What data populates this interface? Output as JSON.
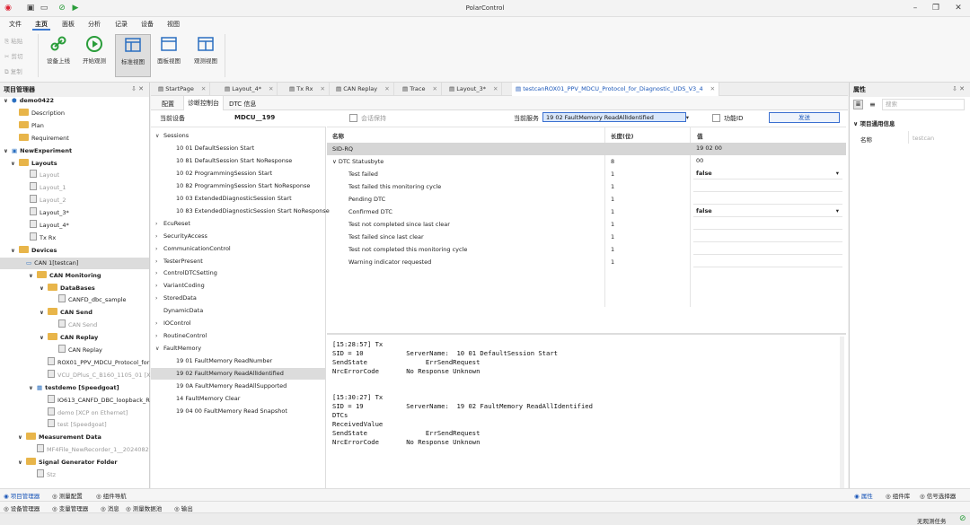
{
  "app": {
    "title": "PolarControl"
  },
  "menu": {
    "items": [
      "文件",
      "主页",
      "面板",
      "分析",
      "记录",
      "设备",
      "视图"
    ],
    "active": "主页"
  },
  "ribbon": {
    "small": [
      "粘贴",
      "剪切",
      "复制"
    ],
    "buttons": [
      "设备上线",
      "开始观测",
      "标准视图",
      "面板视图",
      "观测视图"
    ],
    "selected": "标准视图"
  },
  "left_panel": {
    "title": "项目管理器",
    "rows": [
      {
        "label": "demo0422",
        "icon": "project"
      },
      {
        "label": "Description",
        "icon": "folder"
      },
      {
        "label": "Plan",
        "icon": "folder"
      },
      {
        "label": "Requirement",
        "icon": "folder"
      },
      {
        "label": "NewExperiment",
        "icon": "experiment"
      },
      {
        "label": "Layouts",
        "icon": "folder"
      },
      {
        "label": "Layout",
        "icon": "doc"
      },
      {
        "label": "Layout_1",
        "icon": "doc"
      },
      {
        "label": "Layout_2",
        "icon": "doc"
      },
      {
        "label": "Layout_3*",
        "icon": "doc"
      },
      {
        "label": "Layout_4*",
        "icon": "doc"
      },
      {
        "label": "Tx Rx",
        "icon": "doc"
      },
      {
        "label": "Devices",
        "icon": "folder"
      },
      {
        "label": "CAN 1[testcan]",
        "icon": "can"
      },
      {
        "label": "CAN Monitoring",
        "icon": "folder"
      },
      {
        "label": "DataBases",
        "icon": "folder"
      },
      {
        "label": "CANFD_dbc_sample",
        "icon": "doc"
      },
      {
        "label": "CAN Send",
        "icon": "folder"
      },
      {
        "label": "CAN Send",
        "icon": "doc"
      },
      {
        "label": "CAN Replay",
        "icon": "folder"
      },
      {
        "label": "CAN Replay",
        "icon": "doc"
      },
      {
        "label": "ROX01_PPV_MDCU_Protocol_for",
        "icon": "doc"
      },
      {
        "label": "VCU_DPlus_C_B160_1105_01 [X",
        "icon": "doc"
      },
      {
        "label": "testdemo [Speedgoat]",
        "icon": "device"
      },
      {
        "label": "IO613_CANFD_DBC_loopback_R",
        "icon": "doc"
      },
      {
        "label": "demo [XCP on Ethernet]",
        "icon": "doc"
      },
      {
        "label": "test [Speedgoat]",
        "icon": "doc"
      },
      {
        "label": "Measurement Data",
        "icon": "folder"
      },
      {
        "label": "MF4File_NewRecorder_1__2024082",
        "icon": "doc"
      },
      {
        "label": "Signal Generator Folder",
        "icon": "folder"
      },
      {
        "label": "Stz",
        "icon": "doc"
      }
    ]
  },
  "bottom_tabs": [
    "项目管理器",
    "测量配置",
    "组件导航"
  ],
  "bottom_tabs2": [
    "设备管理器",
    "变量管理器",
    "消息",
    "测量数据池",
    "输出"
  ],
  "right_bottom_tabs": [
    "属性",
    "组件库",
    "信号选择器"
  ],
  "status": {
    "text": "无观测任务"
  },
  "tabs": [
    "StartPage",
    "Layout_4*",
    "Tx Rx",
    "CAN Replay",
    "Trace",
    "Layout_3*",
    "testcanROX01_PPV_MDCU_Protocol_for_Diagnostic_UDS_V3_4"
  ],
  "active_tab": "testcanROX01_PPV_MDCU_Protocol_for_Diagnostic_UDS_V3_4",
  "sub_tabs": [
    "配置",
    "诊断控制台",
    "DTC 信息"
  ],
  "active_sub_tab": "诊断控制台",
  "diag": {
    "device_label": "当前设备",
    "device_value": "MDCU__199",
    "keepalive": "会话保持",
    "service_label": "当前服务",
    "service_value": "19 02 FaultMemory ReadAllIdentified",
    "func_id": "功能ID",
    "send": "发送"
  },
  "services": [
    {
      "label": "Sessions",
      "level": 0,
      "expanded": true
    },
    {
      "label": "10 01 DefaultSession Start",
      "level": 1
    },
    {
      "label": "10 81 DefaultSession Start NoResponse",
      "level": 1
    },
    {
      "label": "10 02 ProgrammingSession Start",
      "level": 1
    },
    {
      "label": "10 82 ProgrammingSession Start NoResponse",
      "level": 1
    },
    {
      "label": "10 03 ExtendedDiagnosticSession Start",
      "level": 1
    },
    {
      "label": "10 83 ExtendedDiagnosticSession Start NoResponse",
      "level": 1
    },
    {
      "label": "EcuReset",
      "level": 0
    },
    {
      "label": "SecurityAccess",
      "level": 0
    },
    {
      "label": "CommunicationControl",
      "level": 0
    },
    {
      "label": "TesterPresent",
      "level": 0
    },
    {
      "label": "ControlDTCSetting",
      "level": 0
    },
    {
      "label": "VariantCoding",
      "level": 0
    },
    {
      "label": "StoredData",
      "level": 0
    },
    {
      "label": "DynamicData",
      "level": 0,
      "noarrow": true
    },
    {
      "label": "IOControl",
      "level": 0
    },
    {
      "label": "RoutineControl",
      "level": 0
    },
    {
      "label": "FaultMemory",
      "level": 0,
      "expanded": true
    },
    {
      "label": "19 01 FaultMemory ReadNumber",
      "level": 1
    },
    {
      "label": "19 02 FaultMemory ReadAllIdentified",
      "level": 1,
      "selected": true
    },
    {
      "label": "19 0A FaultMemory ReadAllSupported",
      "level": 1
    },
    {
      "label": "14 FaultMemory Clear",
      "level": 1
    },
    {
      "label": "19 04 00 FaultMemory Read Snapshot",
      "level": 1
    }
  ],
  "params": {
    "headers": [
      "名称",
      "长度(位)",
      "值"
    ],
    "rows": [
      {
        "name": "SID-RQ",
        "len": "",
        "val": "19 02 00",
        "level": 0,
        "hdr": true
      },
      {
        "name": "DTC Statusbyte",
        "len": "8",
        "val": "00",
        "level": 0,
        "exp": true
      },
      {
        "name": "Test failed",
        "len": "1",
        "val": "false",
        "level": 1,
        "combo": true
      },
      {
        "name": "Test failed this monitoring cycle",
        "len": "1",
        "val": "",
        "level": 1
      },
      {
        "name": "Pending DTC",
        "len": "1",
        "val": "",
        "level": 1
      },
      {
        "name": "Confirmed DTC",
        "len": "1",
        "val": "false",
        "level": 1,
        "combo": true
      },
      {
        "name": "Test not completed since last clear",
        "len": "1",
        "val": "",
        "level": 1
      },
      {
        "name": "Test failed since last clear",
        "len": "1",
        "val": "",
        "level": 1
      },
      {
        "name": "Test not completed this monitoring cycle",
        "len": "1",
        "val": "",
        "level": 1
      },
      {
        "name": "Warning indicator requested",
        "len": "1",
        "val": "",
        "level": 1
      }
    ]
  },
  "log": [
    "[15:28:57] Tx",
    "SID = 10           ServerName:  10 01 DefaultSession Start",
    "SendState               ErrSendRequest",
    "NrcErrorCode       No Response Unknown",
    "",
    "",
    "[15:30:27] Tx",
    "SID = 19           ServerName:  19 02 FaultMemory ReadAllIdentified",
    "DTCs",
    "ReceivedValue",
    "SendState               ErrSendRequest",
    "NrcErrorCode       No Response Unknown"
  ],
  "props": {
    "title": "属性",
    "search_placeholder": "搜索",
    "section": "项目通用信息",
    "name_label": "名称",
    "name_value": "testcan"
  }
}
